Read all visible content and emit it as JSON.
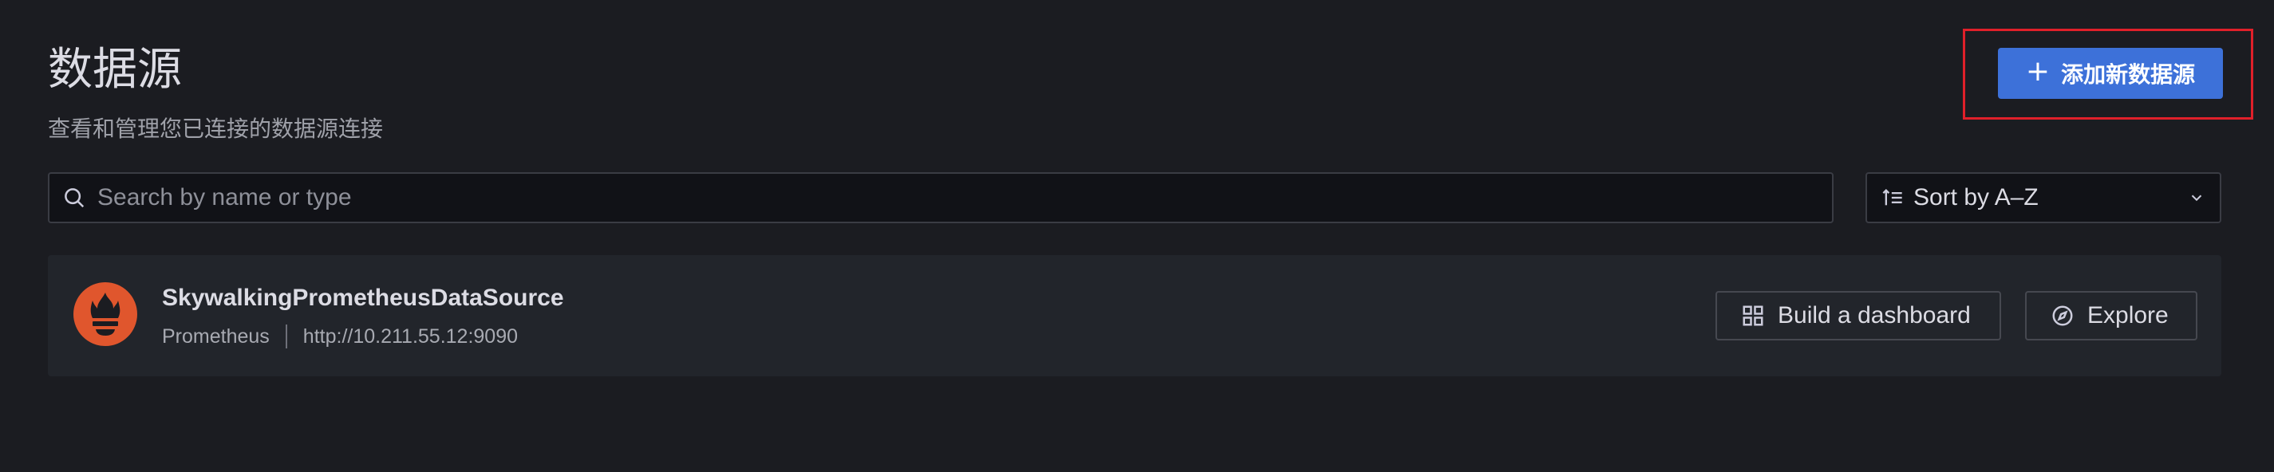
{
  "header": {
    "title": "数据源",
    "subtitle": "查看和管理您已连接的数据源连接",
    "add_button_label": "添加新数据源",
    "add_button_icon": "plus-icon"
  },
  "toolbar": {
    "search_placeholder": "Search by name or type",
    "search_value": "",
    "sort_label": "Sort by A–Z"
  },
  "datasources": [
    {
      "name": "SkywalkingPrometheusDataSource",
      "type": "Prometheus",
      "url": "http://10.211.55.12:9090",
      "logo_color": "#e0562d",
      "actions": {
        "build_label": "Build a dashboard",
        "explore_label": "Explore"
      }
    }
  ],
  "colors": {
    "background": "#1b1c21",
    "primary": "#3d71d9",
    "highlight": "#e0202a",
    "card": "#22252b"
  }
}
